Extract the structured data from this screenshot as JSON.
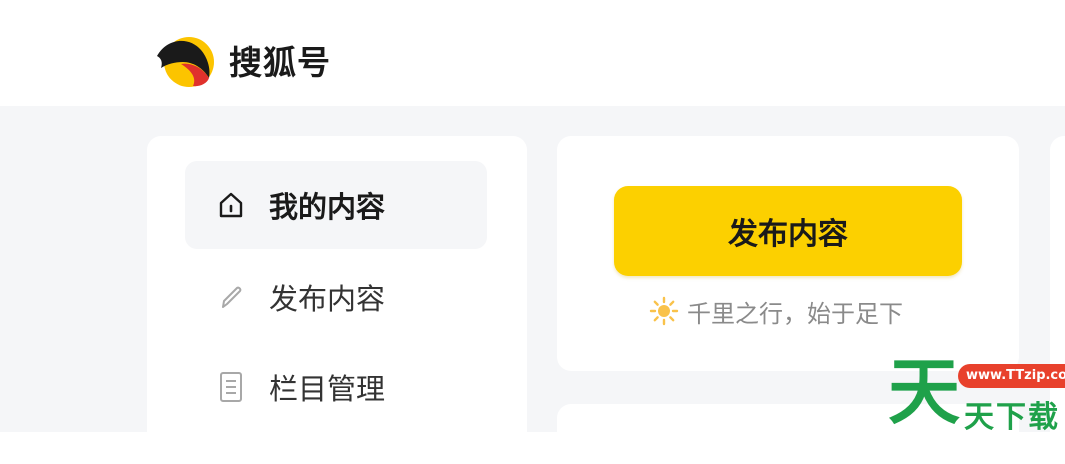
{
  "header": {
    "brand": "搜狐号"
  },
  "sidebar": {
    "items": [
      {
        "label": "我的内容",
        "icon": "home-icon",
        "active": true
      },
      {
        "label": "发布内容",
        "icon": "pencil-icon",
        "active": false
      },
      {
        "label": "栏目管理",
        "icon": "document-icon",
        "active": false
      }
    ]
  },
  "publish": {
    "button_label": "发布内容",
    "motto": "千里之行，始于足下",
    "motto_icon": "sun-icon"
  },
  "watermark": {
    "big_char": "天",
    "url": "www.TTzip.com",
    "sub": "天下载"
  },
  "colors": {
    "accent": "#fcd000",
    "page_bg": "#f5f6f8",
    "watermark_green": "#1fa14a",
    "watermark_red": "#e8412c"
  }
}
